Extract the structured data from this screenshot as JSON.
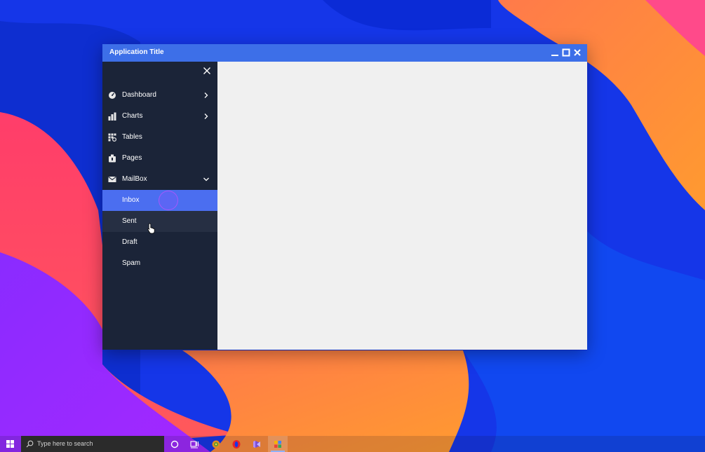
{
  "window": {
    "title": "Application Title",
    "titlebar_color": "#3d6fe8",
    "controls": [
      "minimize-icon",
      "maximize-icon",
      "close-icon"
    ]
  },
  "sidebar": {
    "background": "#1b2438",
    "close_icon": "close-icon",
    "items": [
      {
        "label": "Dashboard",
        "icon": "dashboard-gauge-icon",
        "chevron": "chevron-right-icon"
      },
      {
        "label": "Charts",
        "icon": "bar-chart-icon",
        "chevron": "chevron-right-icon"
      },
      {
        "label": "Tables",
        "icon": "table-icon"
      },
      {
        "label": "Pages",
        "icon": "pages-icon"
      },
      {
        "label": "MailBox",
        "icon": "mail-icon",
        "chevron": "chevron-down-icon",
        "expanded": true
      }
    ],
    "mailbox_items": [
      {
        "label": "Inbox",
        "selected": true
      },
      {
        "label": "Sent",
        "hover": true
      },
      {
        "label": "Draft"
      },
      {
        "label": "Spam"
      }
    ],
    "selected_color": "#4b6ef0"
  },
  "taskbar": {
    "search_placeholder": "Type here to search",
    "icons": [
      "windows-start-icon",
      "search-icon",
      "cortana-circle-icon",
      "task-view-icon",
      "app-icon-1",
      "opera-browser-icon",
      "visual-studio-icon",
      "active-app-icon"
    ]
  }
}
